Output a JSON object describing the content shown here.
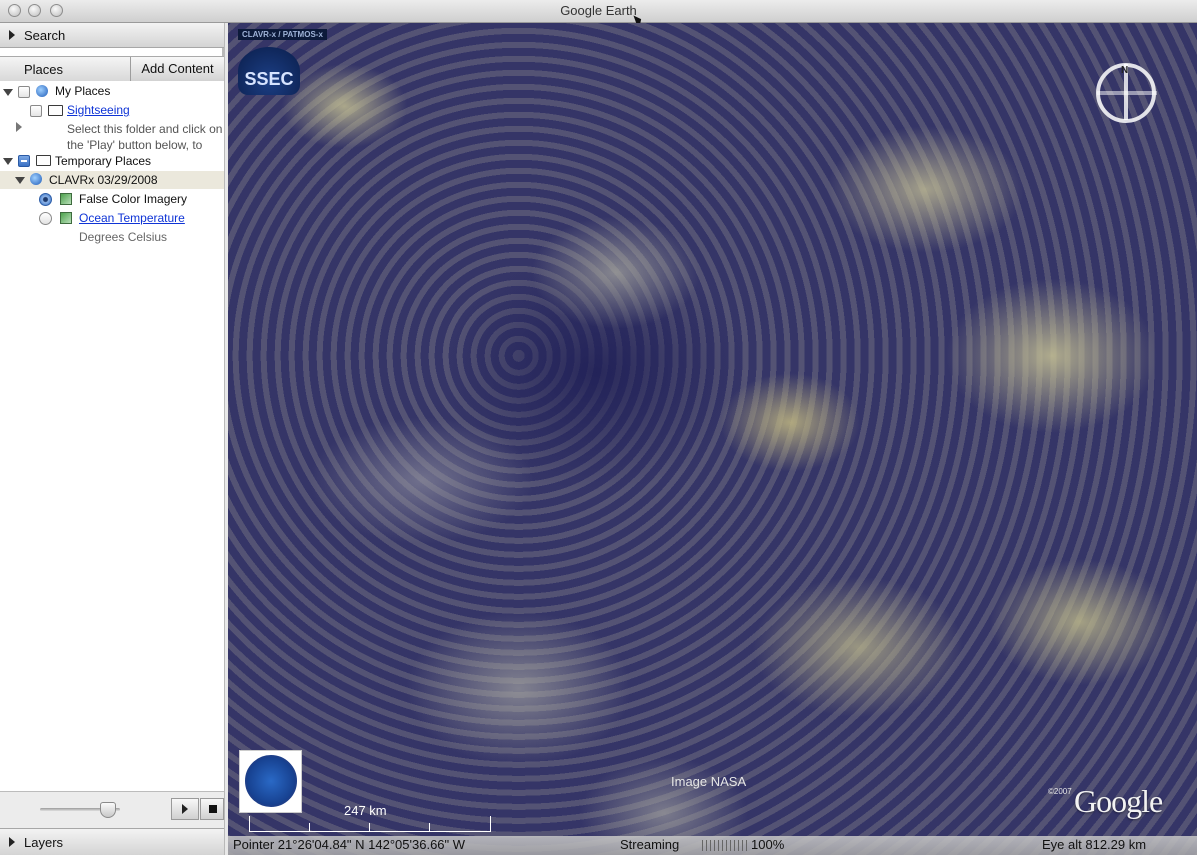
{
  "window": {
    "title": "Google Earth"
  },
  "sidebar": {
    "search_label": "Search",
    "places_label": "Places",
    "add_content_label": "Add Content",
    "layers_label": "Layers",
    "tree": {
      "my_places": "My Places",
      "sightseeing": "Sightseeing",
      "sightseeing_desc_1": "Select this folder and click on",
      "sightseeing_desc_2": "the 'Play' button below, to",
      "temporary_places": "Temporary Places",
      "clavrx": "CLAVRx 03/29/2008",
      "false_color": "False Color Imagery",
      "ocean_temp": "Ocean Temperature",
      "ocean_temp_desc": "Degrees Celsius"
    }
  },
  "view": {
    "clavr_tag": "CLAVR-x / PATMOS-x",
    "ssec_logo": "SSEC",
    "compass_n": "N",
    "image_credit": "Image NASA",
    "scale_label": "247 km",
    "copyright": "©2007",
    "google_logo": "Google",
    "status": {
      "pointer": "Pointer  21°26'04.84\" N  142°05'36.66\" W",
      "streaming_label": "Streaming",
      "streaming_pct": "100%",
      "eye_alt": "Eye alt    812.29 km"
    }
  }
}
